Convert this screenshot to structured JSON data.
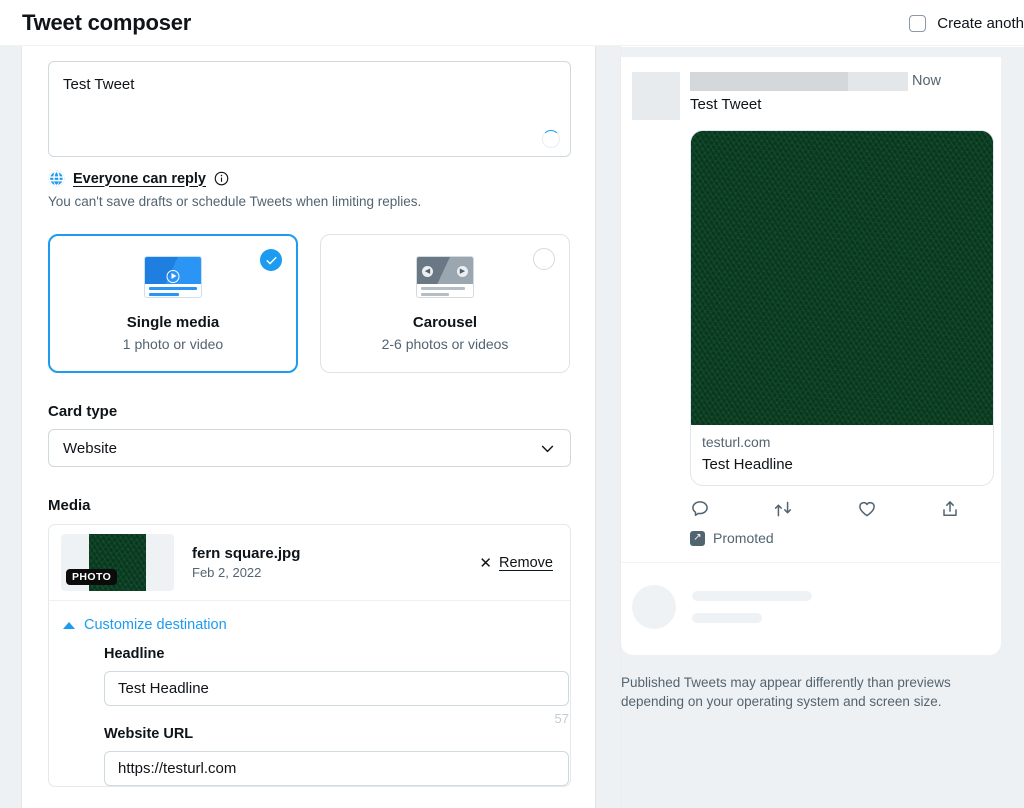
{
  "header": {
    "title": "Tweet composer",
    "create_another_label": "Create anoth"
  },
  "composer": {
    "tweet_text": "Test Tweet",
    "reply_setting": "Everyone can reply",
    "reply_note": "You can't save drafts or schedule Tweets when limiting replies.",
    "globe_icon": "globe-icon",
    "info_icon": "info-icon",
    "spinner_icon": "progress-spinner-icon"
  },
  "media_types": {
    "options": [
      {
        "title": "Single media",
        "subtitle": "1 photo or video",
        "selected": true,
        "icon": "single-media-icon"
      },
      {
        "title": "Carousel",
        "subtitle": "2-6 photos or videos",
        "selected": false,
        "icon": "carousel-icon"
      }
    ]
  },
  "card_type": {
    "label": "Card type",
    "value": "Website",
    "chevron_icon": "chevron-down-icon"
  },
  "media": {
    "label": "Media",
    "badge": "PHOTO",
    "file_name": "fern square.jpg",
    "file_date": "Feb 2, 2022",
    "remove_label": "Remove",
    "remove_icon": "close-icon"
  },
  "customize": {
    "toggle_label": "Customize destination",
    "caret_icon": "caret-up-icon",
    "headline_label": "Headline",
    "headline_value": "Test Headline",
    "headline_counter": "57",
    "url_label": "Website URL",
    "url_value": "https://testurl.com"
  },
  "preview": {
    "timestamp": "Now",
    "tweet_text": "Test Tweet",
    "card_url": "testurl.com",
    "card_headline": "Test Headline",
    "promoted_label": "Promoted",
    "promoted_icon": "promoted-arrow-icon",
    "actions": [
      {
        "name": "reply-icon"
      },
      {
        "name": "retweet-icon"
      },
      {
        "name": "like-icon"
      },
      {
        "name": "share-icon"
      }
    ],
    "disclaimer": "Published Tweets may appear differently than previews depending on your operating system and screen size."
  },
  "colors": {
    "accent": "#1d9bf0",
    "text_primary": "#0f1419",
    "text_secondary": "#536471",
    "border": "#cfd9de",
    "panel_bg": "#eef1f3"
  }
}
